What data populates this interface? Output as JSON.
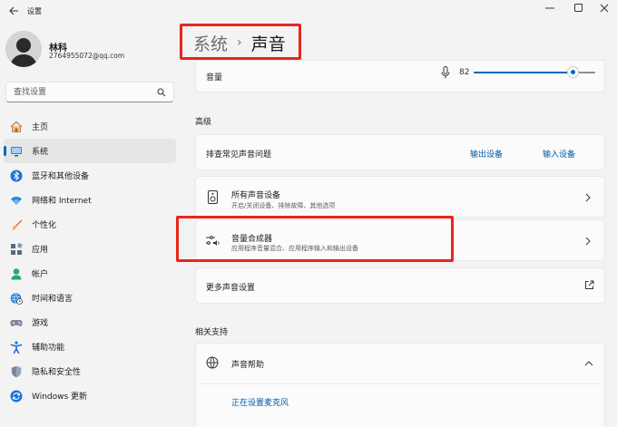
{
  "window": {
    "title": "设置"
  },
  "profile": {
    "name": "林科",
    "email": "2764955072@qq.com"
  },
  "search": {
    "placeholder": "查找设置"
  },
  "sidebar": {
    "items": [
      {
        "label": "主页",
        "icon": "home-icon",
        "active": false
      },
      {
        "label": "系统",
        "icon": "system-icon",
        "active": true
      },
      {
        "label": "蓝牙和其他设备",
        "icon": "bluetooth-icon",
        "active": false
      },
      {
        "label": "网络和 Internet",
        "icon": "wifi-icon",
        "active": false
      },
      {
        "label": "个性化",
        "icon": "brush-icon",
        "active": false
      },
      {
        "label": "应用",
        "icon": "apps-icon",
        "active": false
      },
      {
        "label": "帐户",
        "icon": "person-icon",
        "active": false
      },
      {
        "label": "时间和语言",
        "icon": "globe-clock-icon",
        "active": false
      },
      {
        "label": "游戏",
        "icon": "gamepad-icon",
        "active": false
      },
      {
        "label": "辅助功能",
        "icon": "accessibility-icon",
        "active": false
      },
      {
        "label": "隐私和安全性",
        "icon": "shield-icon",
        "active": false
      },
      {
        "label": "Windows 更新",
        "icon": "update-icon",
        "active": false
      }
    ]
  },
  "breadcrumb": {
    "parent": "系统",
    "separator": "›",
    "current": "声音"
  },
  "volume": {
    "label": "音量",
    "value": "82",
    "level": 0.82
  },
  "advanced": {
    "title": "高级",
    "troubleshoot": {
      "label": "排查常见声音问题",
      "output_link": "输出设备",
      "input_link": "输入设备"
    },
    "all_devices": {
      "title": "所有声音设备",
      "subtitle": "开启/关闭设备、排除故障、其他选项"
    },
    "mixer": {
      "title": "音量合成器",
      "subtitle": "应用程序音量混合、应用程序输入和输出设备"
    },
    "more_settings": {
      "label": "更多声音设置"
    }
  },
  "related": {
    "title": "相关支持",
    "help": {
      "label": "声音帮助",
      "link": "正在设置麦克风"
    }
  },
  "colors": {
    "accent": "#0067c0",
    "highlight": "#e8261a",
    "link": "#0058a8"
  }
}
